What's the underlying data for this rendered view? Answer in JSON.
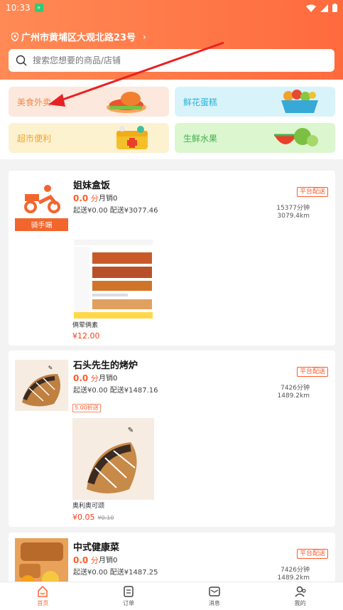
{
  "status": {
    "time": "10:33"
  },
  "header": {
    "location": "广州市黄埔区大观北路23号",
    "search_placeholder": "搜索您想要的商品/店铺"
  },
  "categories": [
    {
      "label": "美食外卖"
    },
    {
      "label": "鲜花蛋糕"
    },
    {
      "label": "超市便利"
    },
    {
      "label": "生鲜水果"
    }
  ],
  "stores": [
    {
      "name": "姐妹盒饭",
      "logo_text": "骑手端",
      "score_value": "0.0",
      "score_unit": "分",
      "sales": "月销0",
      "fee": "起送¥0.00 配送¥3077.46",
      "tag": "平台配送",
      "time": "15377分钟",
      "distance": "3079.4km",
      "product": {
        "name": "俩荤俩素",
        "price": "¥12.00"
      }
    },
    {
      "name": "石头先生的烤炉",
      "score_value": "0.0",
      "score_unit": "分",
      "sales": "月销0",
      "fee": "起送¥0.00 配送¥1487.16",
      "tag": "平台配送",
      "time": "7426分钟",
      "distance": "1489.2km",
      "discount": "5.00折送",
      "product": {
        "name": "奥利奥可颂",
        "price": "¥0.05",
        "old_price": "¥0.10"
      }
    },
    {
      "name": "中式健康菜",
      "score_value": "0.0",
      "score_unit": "分",
      "sales": "月销0",
      "fee": "起送¥0.00 配送¥1487.25",
      "tag": "平台配送",
      "time": "7426分钟",
      "distance": "1489.2km"
    }
  ],
  "tabbar": [
    {
      "label": "首页"
    },
    {
      "label": "订单"
    },
    {
      "label": "消息"
    },
    {
      "label": "我的"
    }
  ],
  "colors": {
    "primary": "#ff6a3d",
    "price": "#ff3c1a"
  }
}
